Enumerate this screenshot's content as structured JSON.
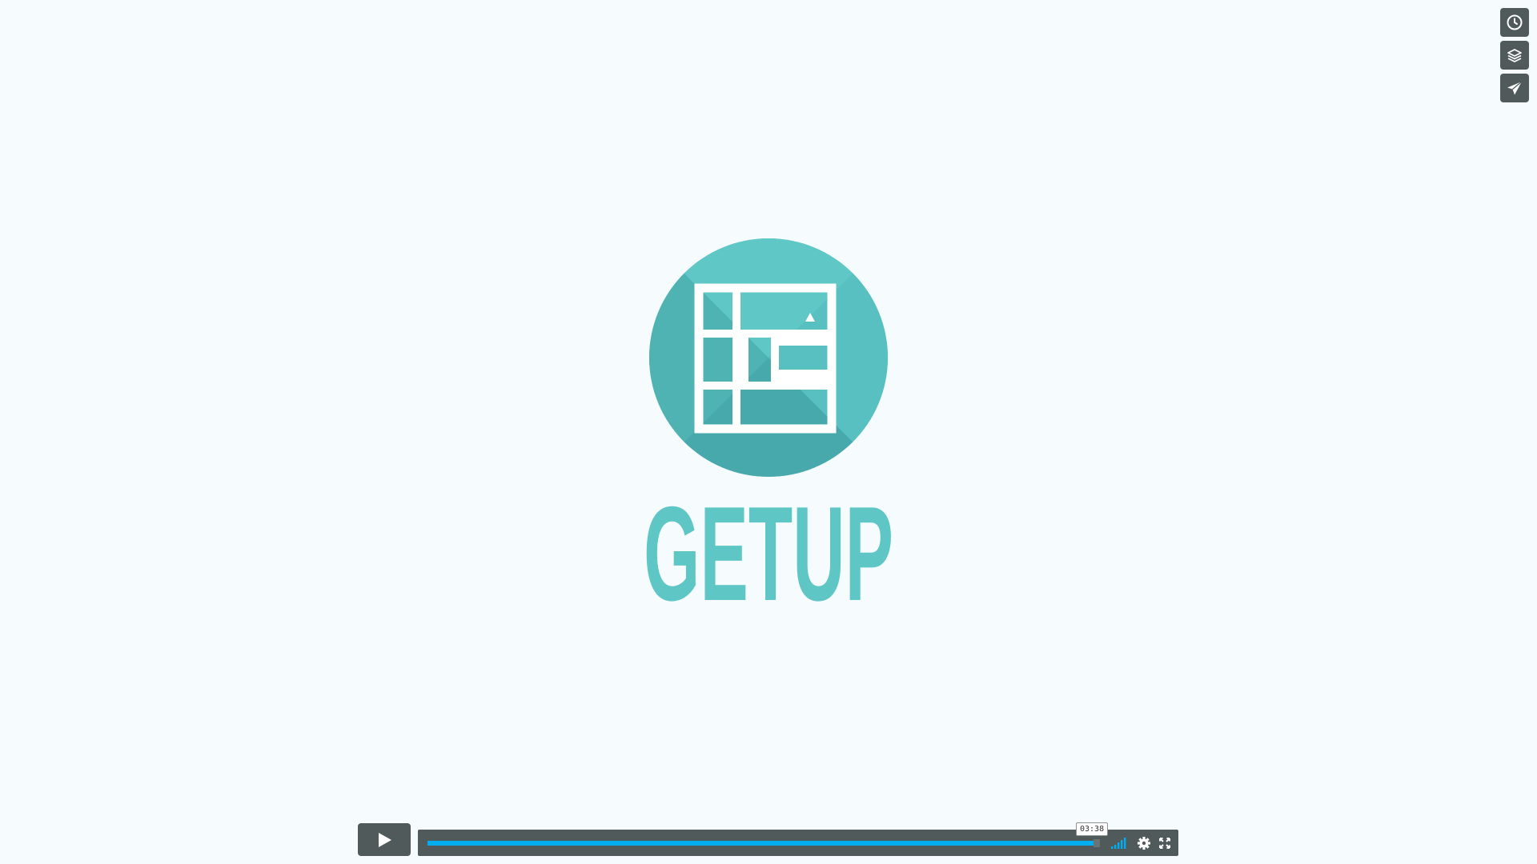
{
  "video": {
    "brand_name": "GETUP",
    "brand_color": "#5ec6c5",
    "background_color": "#f6fbfe"
  },
  "side_actions": [
    {
      "name": "watch-later",
      "icon": "clock-icon"
    },
    {
      "name": "collections",
      "icon": "layers-icon"
    },
    {
      "name": "share",
      "icon": "paper-plane-icon"
    }
  ],
  "player": {
    "play_icon": "play-icon",
    "progress_fraction": 0.995,
    "time_tooltip": "03:38",
    "volume_level_fraction": 1.0,
    "progress_color": "#00adef",
    "controls_color": "#505a5b"
  }
}
